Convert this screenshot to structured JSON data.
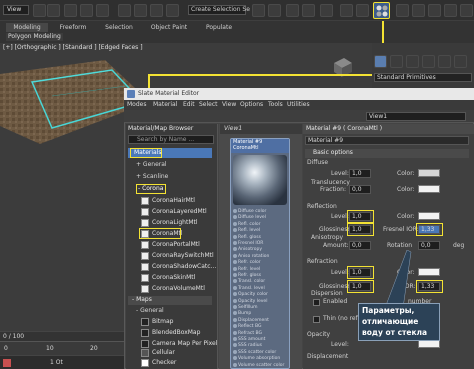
{
  "toolbar": {
    "view_label": "View",
    "selection_set_placeholder": "Create Selection Se"
  },
  "ribbon": {
    "tabs": [
      "Modeling",
      "Freeform",
      "Selection",
      "Object Paint",
      "Populate"
    ],
    "sub_label": "Polygon Modeling"
  },
  "viewport": {
    "label": "[+] [Orthographic ] [Standard ] [Edged Faces ]",
    "ruler_ticks": [
      "0 / 100",
      "0",
      "10",
      "20"
    ],
    "bottom_value": "1 Ot"
  },
  "command_panel": {
    "dropdown": "Standard Primitives"
  },
  "editor": {
    "title": "Slate Material Editor",
    "menu": [
      "Modes",
      "Material",
      "Edit",
      "Select",
      "View",
      "Options",
      "Tools",
      "Utilities"
    ],
    "view_tab": "View1",
    "browser": {
      "title": "Material/Map Browser",
      "search_placeholder": "Search by Name ...",
      "materials_label": "Materials",
      "general_label": "+ General",
      "scanline_label": "+ Scanline",
      "corona_label": "- Corona",
      "corona_items": [
        "CoronaHairMtl",
        "CoronaLayeredMtl",
        "CoronaLightMtl",
        "CoronaMtl",
        "CoronaPortalMtl",
        "CoronaRaySwitchMtl",
        "CoronaShadowCatc...",
        "CoronaSkinMtl",
        "CoronaVolumeMtl"
      ],
      "maps_label": "- Maps",
      "maps_general_label": "- General",
      "maps_items": [
        "Bitmap",
        "BlendedBoxMap",
        "Camera Map Per Pixel",
        "Cellular",
        "Checker"
      ]
    },
    "node": {
      "title": "Material #9",
      "subtitle": "CoronaMtl",
      "slots": [
        "Diffuse color",
        "Diffuse level",
        "Refl. color",
        "Refl. level",
        "Refl. gloss",
        "Fresnel IOR",
        "Anisotropy",
        "Aniso rotation",
        "Refr. color",
        "Refr. level",
        "Refr. gloss",
        "Transl. color",
        "Transl. level",
        "Opacity color",
        "Opacity level",
        "SelfIllum",
        "Bump",
        "Displacement",
        "Reflect BG",
        "Refract BG",
        "SSS amount",
        "SSS radius",
        "SSS scatter color",
        "Volume absorption",
        "Volume scatter color"
      ]
    },
    "params": {
      "title": "Material #9  ( CoronaMtl )",
      "name_field": "Material #9",
      "section": "Basic options",
      "diffuse": {
        "header": "Diffuse",
        "level_label": "Level:",
        "level": "1,0",
        "color_label": "Color:"
      },
      "translucency": {
        "header": "Translucency",
        "fraction_label": "Fraction:",
        "fraction": "0,0",
        "color_label": "Color:"
      },
      "reflection": {
        "header": "Reflection",
        "level_label": "Level:",
        "level": "1,0",
        "color_label": "Color:",
        "gloss_label": "Glossiness:",
        "gloss": "1,0",
        "ior_label": "Fresnel IOR:",
        "ior": "1,33"
      },
      "anisotropy": {
        "header": "Anisotropy",
        "amount_label": "Amount:",
        "amount": "0,0",
        "rotation_label": "Rotation",
        "rotation": "0,0",
        "unit": "deg"
      },
      "refraction": {
        "header": "Refraction",
        "level_label": "Level:",
        "level": "1,0",
        "color_label": "Color:",
        "gloss_label": "Glossiness:",
        "gloss": "1,0",
        "ior_label": "IOR:",
        "ior": "1,33"
      },
      "dispersion": {
        "header": "Dispersion",
        "enabled_label": "Enabled",
        "abbe": "number"
      },
      "thin_label": "Thin (no refraction)",
      "opacity": {
        "header": "Opacity",
        "level_label": "Level:"
      },
      "displacement_header": "Displacement"
    }
  },
  "annotation": {
    "lines": [
      "Параметры,",
      "отличающие",
      "воду от стекла"
    ]
  },
  "colors": {
    "highlight": "#f3e233",
    "selection_blue": "#4a78b8",
    "annotation_bg": "#2c4257"
  }
}
